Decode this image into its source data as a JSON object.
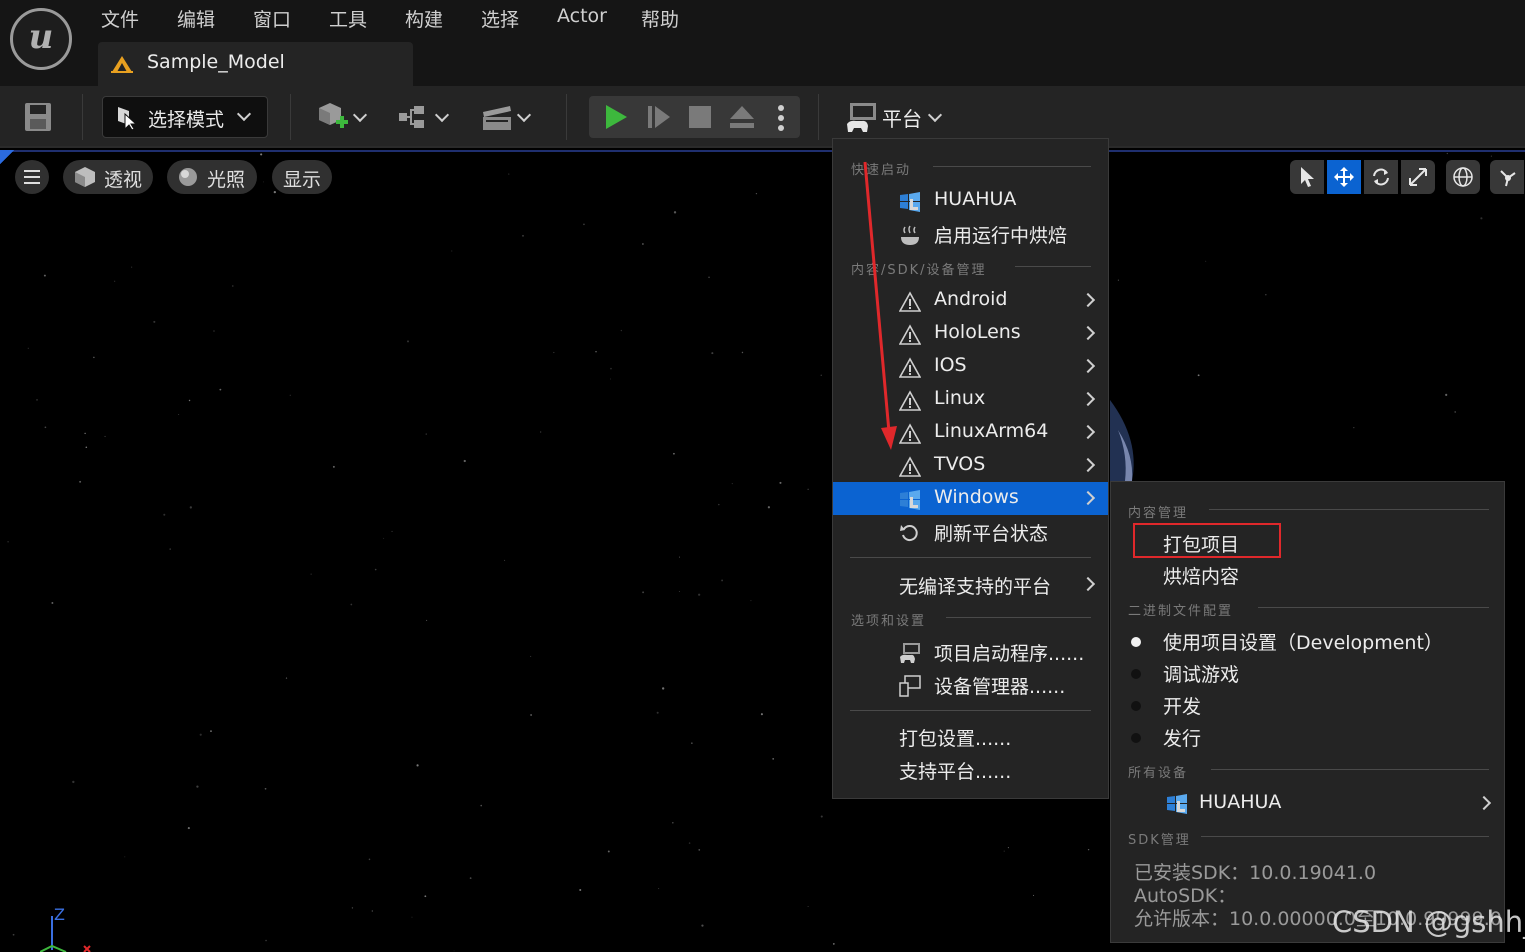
{
  "menubar": {
    "items": [
      "文件",
      "编辑",
      "窗口",
      "工具",
      "构建",
      "选择",
      "Actor",
      "帮助"
    ]
  },
  "level_tab": {
    "label": "Sample_Model"
  },
  "toolbar": {
    "mode_label": "选择模式",
    "platform_label": "平台"
  },
  "viewport": {
    "perspective_label": "透视",
    "lighting_label": "光照",
    "show_label": "显示",
    "axis_z": "Z"
  },
  "platform_menu": {
    "quick_launch_header": "快速启动",
    "quick_launch": [
      {
        "label": "HUAHUA",
        "icon": "windows-icon"
      },
      {
        "label": "启用运行中烘焙",
        "icon": "cook-icon"
      }
    ],
    "sdk_header": "内容/SDK/设备管理",
    "platforms": [
      {
        "label": "Android",
        "icon": "warning-icon"
      },
      {
        "label": "HoloLens",
        "icon": "warning-icon"
      },
      {
        "label": "IOS",
        "icon": "warning-icon"
      },
      {
        "label": "Linux",
        "icon": "warning-icon"
      },
      {
        "label": "LinuxArm64",
        "icon": "warning-icon"
      },
      {
        "label": "TVOS",
        "icon": "warning-icon"
      },
      {
        "label": "Windows",
        "icon": "windows-icon"
      }
    ],
    "refresh_label": "刷新平台状态",
    "no_compile_label": "无编译支持的平台",
    "options_header": "选项和设置",
    "project_launcher_label": "项目启动程序......",
    "device_manager_label": "设备管理器......",
    "packaging_settings_label": "打包设置......",
    "supported_platforms_label": "支持平台......"
  },
  "windows_menu": {
    "content_header": "内容管理",
    "package_project_label": "打包项目",
    "cook_content_label": "烘焙内容",
    "binary_header": "二进制文件配置",
    "configs": [
      {
        "label": "使用项目设置（Development）",
        "selected": true
      },
      {
        "label": "调试游戏",
        "selected": false
      },
      {
        "label": "开发",
        "selected": false
      },
      {
        "label": "发行",
        "selected": false
      }
    ],
    "devices_header": "所有设备",
    "device_label": "HUAHUA",
    "sdk_header": "SDK管理",
    "installed_sdk": "已安装SDK：10.0.19041.0",
    "auto_sdk": "AutoSDK：",
    "allowed_versions": "允许版本：10.0.00000.0至10.0.99999.0"
  },
  "watermark": "CSDN @gshh_",
  "colors": {
    "selection": "#0b63d1",
    "highlight_box": "#e0282b",
    "play_green": "#3db83d"
  }
}
